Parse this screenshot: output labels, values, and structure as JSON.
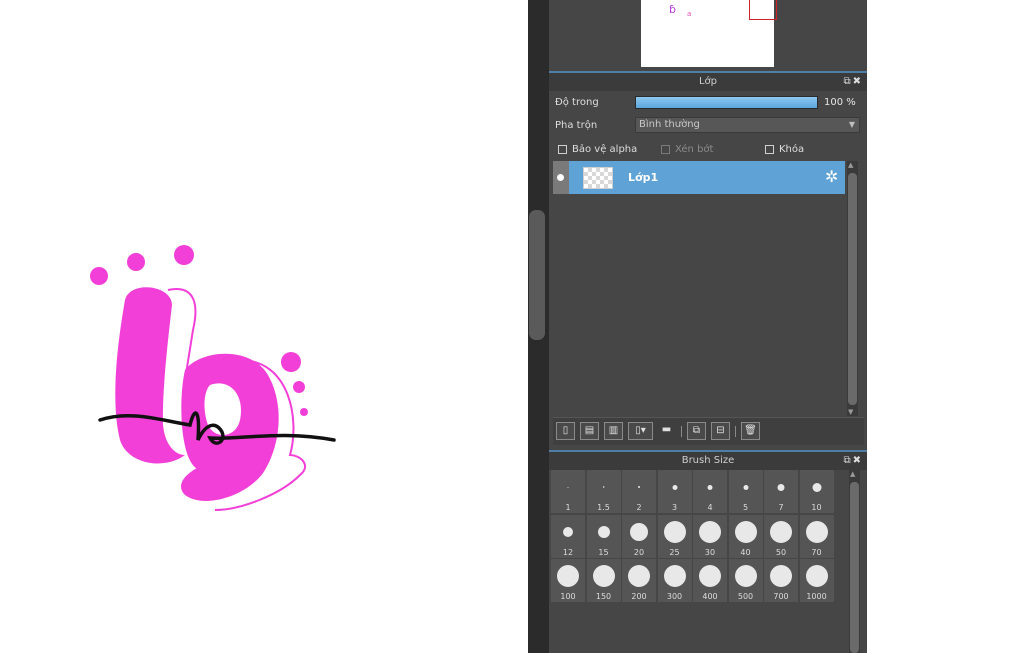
{
  "layer_panel": {
    "title": "Lớp",
    "opacity_label": "Độ trong",
    "opacity_value": "100 %",
    "opacity_fraction": 1.0,
    "blend_label": "Pha trộn",
    "blend_value": "Bình thường",
    "checkboxes": {
      "alpha_protect": "Bảo vệ alpha",
      "clipping": "Xén bớt",
      "lock": "Khóa"
    },
    "layers": [
      {
        "name": "Lớp1",
        "visible": true,
        "selected": true
      }
    ]
  },
  "brush_panel": {
    "title": "Brush Size",
    "sizes": [
      "1",
      "1.5",
      "2",
      "3",
      "4",
      "5",
      "7",
      "10",
      "12",
      "15",
      "20",
      "25",
      "30",
      "40",
      "50",
      "70",
      "100",
      "150",
      "200",
      "300",
      "400",
      "500",
      "700",
      "1000"
    ]
  },
  "icons": {
    "panel_popout": "popout-icon",
    "panel_close": "close-icon",
    "layer_settings": "gear-icon",
    "toolbar": [
      "new-layer-icon",
      "new-halftone-layer-icon",
      "new-8bit-layer-icon",
      "add-layer-menu-icon",
      "new-folder-icon",
      "duplicate-layer-icon",
      "merge-layer-icon",
      "delete-layer-icon"
    ]
  },
  "colors": {
    "accent_blue": "#5ea2d6",
    "artwork_pink": "#f23fd8",
    "panel_bg": "#464646"
  }
}
